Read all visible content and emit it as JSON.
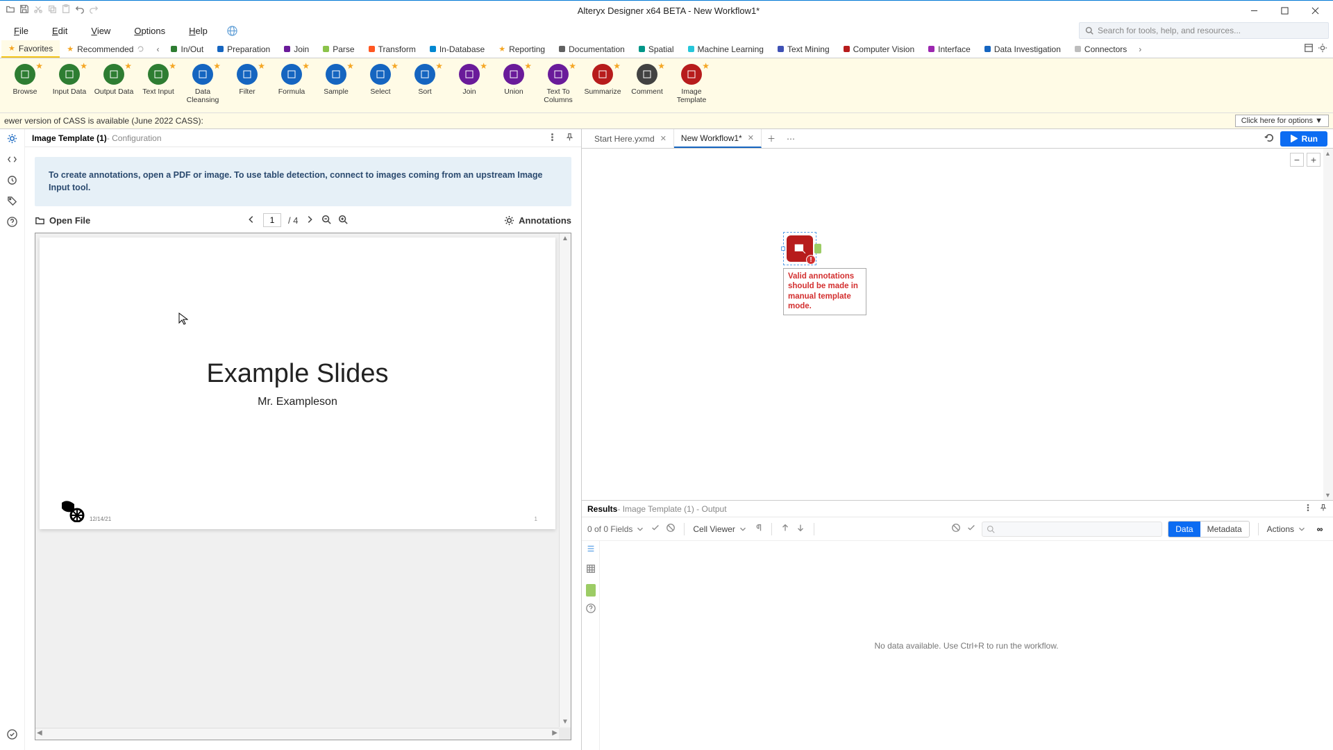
{
  "title": "Alteryx Designer x64 BETA - New Workflow1*",
  "menus": [
    "File",
    "Edit",
    "View",
    "Options",
    "Help"
  ],
  "search_placeholder": "Search for tools, help, and resources...",
  "categories": [
    {
      "label": "Favorites",
      "color": "#f5a623",
      "star": true,
      "active": true
    },
    {
      "label": "Recommended",
      "color": "#f5a623",
      "star": true
    },
    {
      "label": "In/Out",
      "color": "#2e7d32"
    },
    {
      "label": "Preparation",
      "color": "#1565c0"
    },
    {
      "label": "Join",
      "color": "#6a1b9a"
    },
    {
      "label": "Parse",
      "color": "#8bc34a"
    },
    {
      "label": "Transform",
      "color": "#ff5722"
    },
    {
      "label": "In-Database",
      "color": "#0288d1"
    },
    {
      "label": "Reporting",
      "color": "#f5a623",
      "star": true
    },
    {
      "label": "Documentation",
      "color": "#616161"
    },
    {
      "label": "Spatial",
      "color": "#009688"
    },
    {
      "label": "Machine Learning",
      "color": "#26c6da"
    },
    {
      "label": "Text Mining",
      "color": "#3f51b5"
    },
    {
      "label": "Computer Vision",
      "color": "#b71c1c"
    },
    {
      "label": "Interface",
      "color": "#9c27b0"
    },
    {
      "label": "Data Investigation",
      "color": "#1565c0"
    },
    {
      "label": "Connectors",
      "color": "#bdbdbd"
    }
  ],
  "tools": [
    {
      "label": "Browse",
      "cls": "c-green"
    },
    {
      "label": "Input Data",
      "cls": "c-green"
    },
    {
      "label": "Output Data",
      "cls": "c-green"
    },
    {
      "label": "Text Input",
      "cls": "c-green"
    },
    {
      "label": "Data Cleansing",
      "cls": "c-blue"
    },
    {
      "label": "Filter",
      "cls": "c-blue"
    },
    {
      "label": "Formula",
      "cls": "c-blue"
    },
    {
      "label": "Sample",
      "cls": "c-blue"
    },
    {
      "label": "Select",
      "cls": "c-blue"
    },
    {
      "label": "Sort",
      "cls": "c-blue"
    },
    {
      "label": "Join",
      "cls": "c-purple"
    },
    {
      "label": "Union",
      "cls": "c-purple"
    },
    {
      "label": "Text To Columns",
      "cls": "c-purple"
    },
    {
      "label": "Summarize",
      "cls": "c-red"
    },
    {
      "label": "Comment",
      "cls": "c-dgrey"
    },
    {
      "label": "Image Template",
      "cls": "c-red"
    }
  ],
  "banner": {
    "text": "ewer version of CASS is available (June 2022 CASS):",
    "button": "Click here for options ▼"
  },
  "config": {
    "title_bold": "Image Template (1)",
    "title_rest": " - Configuration",
    "info": "To create annotations, open a PDF or image. To use table detection, connect to images coming from an upstream Image Input tool.",
    "open_file": "Open File",
    "page_current": "1",
    "page_sep": "/ 4",
    "annotations": "Annotations"
  },
  "doc": {
    "title": "Example Slides",
    "subtitle": "Mr. Exampleson",
    "date": "12/14/21",
    "page_num": "1"
  },
  "tabs": [
    {
      "label": "Start Here.yxmd",
      "active": false
    },
    {
      "label": "New Workflow1*",
      "active": true
    }
  ],
  "run_label": "Run",
  "canvas_error": "Valid annotations should be made in manual template mode.",
  "results": {
    "title_bold": "Results",
    "title_rest": " - Image Template (1) - Output",
    "fields": "0 of 0 Fields",
    "viewer": "Cell Viewer",
    "data": "Data",
    "metadata": "Metadata",
    "actions": "Actions",
    "links_glyph": "∞",
    "empty": "No data available. Use Ctrl+R to run the workflow."
  }
}
